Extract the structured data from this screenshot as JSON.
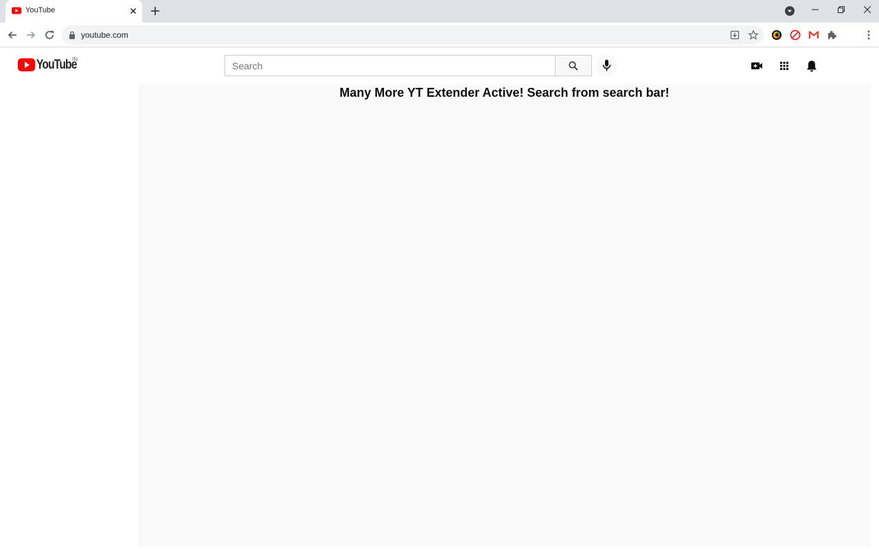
{
  "browser": {
    "tab": {
      "title": "YouTube",
      "favicon": "youtube-favicon-icon"
    },
    "new_tab_icon": "plus-icon",
    "window_controls": [
      "profile-icon",
      "minimize-icon",
      "restore-icon",
      "close-icon"
    ],
    "toolbar": {
      "url": "youtube.com",
      "nav_icons": [
        "back-arrow-icon",
        "forward-arrow-icon",
        "reload-icon"
      ],
      "omnibox_icons": [
        "install-icon",
        "bookmark-star-icon"
      ],
      "extensions": [
        "color-wheel-extension-icon",
        "adblock-extension-icon",
        "gmail-extension-icon",
        "puzzle-extensions-icon",
        "kebab-menu-icon"
      ]
    }
  },
  "youtube": {
    "logo_text": "YouTube",
    "country_code": "IN",
    "search": {
      "placeholder": "Search",
      "value": ""
    },
    "header_icons": [
      "create-video-icon",
      "apps-grid-icon",
      "notifications-bell-icon"
    ],
    "banner_text": "Many More YT Extender Active! Search from search bar!"
  },
  "colors": {
    "brand_red": "#ff0000",
    "tabstrip_bg": "#dee1e6",
    "omnibox_bg": "#f1f3f4",
    "content_bg": "#f9f9f9"
  }
}
